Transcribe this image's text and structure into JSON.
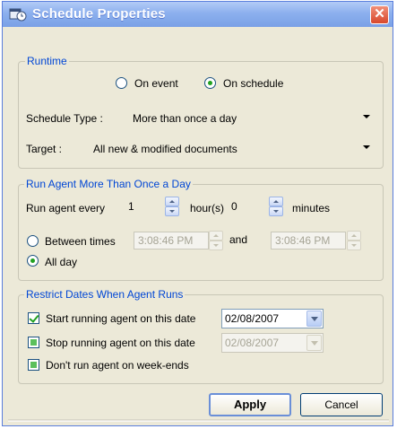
{
  "window": {
    "title": "Schedule Properties",
    "close_label": "✕"
  },
  "runtime": {
    "legend": "Runtime",
    "on_event_label": "On event",
    "on_schedule_label": "On schedule",
    "selected": "On schedule",
    "schedule_type_label": "Schedule Type :",
    "schedule_type_value": "More than once a day",
    "target_label": "Target :",
    "target_value": "All new & modified documents"
  },
  "run_more": {
    "legend": "Run Agent More Than Once a Day",
    "run_every_label": "Run agent every",
    "hours_value": "1",
    "hours_label": "hour(s)",
    "minutes_value": "0",
    "minutes_label": "minutes",
    "between_times_label": "Between times",
    "time_from": "3:08:46 PM",
    "and_label": "and",
    "time_to": "3:08:46 PM",
    "all_day_label": "All day",
    "selected": "All day"
  },
  "restrict": {
    "legend": "Restrict Dates When Agent Runs",
    "start_label": "Start running agent on this date",
    "start_date": "02/08/2007",
    "start_checked": true,
    "stop_label": "Stop running agent on this date",
    "stop_date": "02/08/2007",
    "stop_checked": false,
    "weekends_label": "Don't run agent on week-ends",
    "weekends_checked": false
  },
  "buttons": {
    "apply": "Apply",
    "cancel": "Cancel"
  },
  "colors": {
    "legend": "#0046d5",
    "title_bar": "#7aa0e6",
    "dialog_bg": "#ece9d8",
    "radio_dot": "#21a121"
  }
}
